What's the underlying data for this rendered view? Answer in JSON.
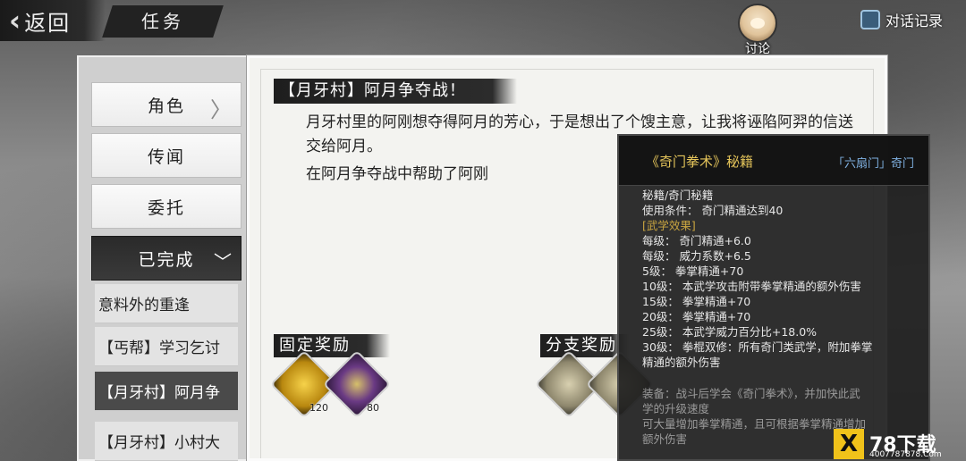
{
  "header": {
    "back_label": "返回",
    "title": "任务",
    "discuss_label": "讨论",
    "dialog_log_label": "对话记录"
  },
  "categories": [
    {
      "label": "角色",
      "arrow": "〉"
    },
    {
      "label": "传闻"
    },
    {
      "label": "委托"
    },
    {
      "label": "已完成",
      "arrow": "﹀"
    }
  ],
  "quest_list": [
    "意料外的重逢",
    "【丐帮】学习乞讨",
    "【月牙村】阿月争",
    "【月牙村】小村大"
  ],
  "quest": {
    "title": "【月牙村】阿月争夺战！",
    "description": "月牙村里的阿刚想夺得阿月的芳心，于是想出了个馊主意，让我将诬陷阿羿的信送交给阿月。",
    "progress": "在阿月争夺战中帮助了阿刚"
  },
  "rewards": {
    "fixed_label": "固定奖励",
    "branch_label": "分支奖励",
    "fixed_items": [
      {
        "icon": "gold-coin-icon",
        "count": "120"
      },
      {
        "icon": "copper-coin-icon",
        "count": "80"
      }
    ]
  },
  "tooltip": {
    "name": "《奇门拳术》秘籍",
    "school": "「六扇门」奇门",
    "type": "秘籍/奇门秘籍",
    "requirement": "使用条件：  奇门精通达到40",
    "effects_header": "[武学效果]",
    "effects": [
      "每级：  奇门精通+6.0",
      "每级：  威力系数+6.5",
      "5级：  拳掌精通+70",
      "10级：  本武学攻击附带拳掌精通的额外伤害",
      "15级：  拳掌精通+70",
      "20级：  拳掌精通+70",
      "25级：  本武学威力百分比+18.0%",
      "30级：  拳棍双修：所有奇门类武学，附加拳掌",
      "精通的额外伤害"
    ],
    "equip_lines": [
      "装备：战斗后学会《奇门拳术》，并加快此武",
      "学的升级速度",
      "可大量增加拳掌精通，且可根据拳掌精通增加",
      "额外伤害"
    ]
  },
  "watermark": {
    "mark": "X",
    "text": "78下载",
    "url": "4007787878.Com"
  }
}
